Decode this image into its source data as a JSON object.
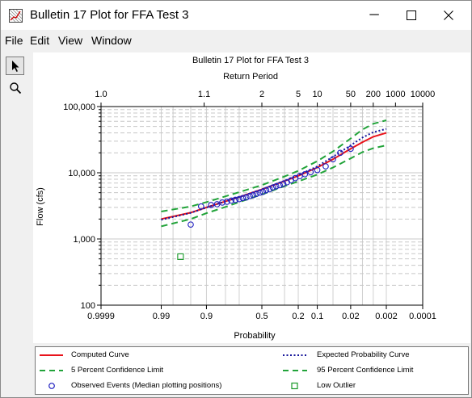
{
  "window": {
    "title": "Bulletin 17 Plot for FFA Test 3",
    "minimize_glyph": "─",
    "maximize_glyph": "☐",
    "close_glyph": "✕"
  },
  "menu": {
    "items": [
      "File",
      "Edit",
      "View",
      "Window"
    ]
  },
  "toolbar": {
    "tools": [
      "pointer-tool",
      "zoom-tool"
    ]
  },
  "chart_data": {
    "type": "line",
    "title": "Bulletin 17 Plot for FFA Test 3",
    "top_axis_label": "Return Period",
    "xlabel": "Probability",
    "ylabel": "Flow (cfs)",
    "y_scale": "log",
    "ylim": [
      100,
      100000
    ],
    "x_scale": "probability",
    "xlim": [
      0.9999,
      0.0001
    ],
    "x_ticks": [
      0.9999,
      0.99,
      0.9,
      0.5,
      0.2,
      0.1,
      0.02,
      0.002,
      0.0001
    ],
    "x_tick_labels": [
      "0.9999",
      "0.99",
      "0.9",
      "0.5",
      "0.2",
      "0.1",
      "0.02",
      "0.002",
      "0.0001"
    ],
    "top_ticks": [
      1.0,
      1.1,
      2,
      5,
      10,
      50,
      200,
      1000,
      10000
    ],
    "top_tick_labels": [
      "1.0",
      "1.1",
      "2",
      "5",
      "10",
      "50",
      "200",
      "1000",
      "10000"
    ],
    "y_ticks": [
      100,
      1000,
      10000,
      100000
    ],
    "y_tick_labels": [
      "100",
      "1,000",
      "10,000",
      "100,000"
    ],
    "grid": true,
    "legend_placement": "bottom",
    "series": [
      {
        "name": "Computed Curve",
        "color": "#e8131b",
        "style": "solid",
        "points": [
          [
            0.99,
            2000
          ],
          [
            0.95,
            2500
          ],
          [
            0.9,
            3000
          ],
          [
            0.8,
            3700
          ],
          [
            0.7,
            4300
          ],
          [
            0.5,
            5600
          ],
          [
            0.3,
            7500
          ],
          [
            0.2,
            9000
          ],
          [
            0.1,
            12000
          ],
          [
            0.05,
            16000
          ],
          [
            0.02,
            23000
          ],
          [
            0.01,
            29000
          ],
          [
            0.005,
            35000
          ],
          [
            0.002,
            40000
          ]
        ]
      },
      {
        "name": "Expected Probability Curve",
        "color": "#15159a",
        "style": "dotted",
        "points": [
          [
            0.99,
            1950
          ],
          [
            0.95,
            2480
          ],
          [
            0.9,
            2980
          ],
          [
            0.8,
            3700
          ],
          [
            0.7,
            4300
          ],
          [
            0.5,
            5600
          ],
          [
            0.3,
            7600
          ],
          [
            0.2,
            9200
          ],
          [
            0.1,
            12500
          ],
          [
            0.05,
            17500
          ],
          [
            0.02,
            26000
          ],
          [
            0.01,
            34000
          ],
          [
            0.005,
            41000
          ],
          [
            0.002,
            46000
          ]
        ]
      },
      {
        "name": "5 Percent Confidence Limit",
        "color": "#22a33a",
        "style": "dashed",
        "points": [
          [
            0.99,
            2600
          ],
          [
            0.95,
            3100
          ],
          [
            0.9,
            3600
          ],
          [
            0.8,
            4400
          ],
          [
            0.7,
            5100
          ],
          [
            0.5,
            6500
          ],
          [
            0.3,
            8800
          ],
          [
            0.2,
            10700
          ],
          [
            0.1,
            15000
          ],
          [
            0.05,
            21000
          ],
          [
            0.02,
            33000
          ],
          [
            0.01,
            45000
          ],
          [
            0.005,
            55000
          ],
          [
            0.002,
            62000
          ]
        ]
      },
      {
        "name": "95 Percent Confidence Limit",
        "color": "#22a33a",
        "style": "dashed",
        "points": [
          [
            0.99,
            1550
          ],
          [
            0.95,
            2000
          ],
          [
            0.9,
            2450
          ],
          [
            0.8,
            3050
          ],
          [
            0.7,
            3600
          ],
          [
            0.5,
            4700
          ],
          [
            0.3,
            6300
          ],
          [
            0.2,
            7400
          ],
          [
            0.1,
            9400
          ],
          [
            0.05,
            12000
          ],
          [
            0.02,
            16500
          ],
          [
            0.01,
            20500
          ],
          [
            0.005,
            23500
          ],
          [
            0.002,
            26000
          ]
        ]
      }
    ],
    "observed_events": {
      "name": "Observed Events (Median plotting positions)",
      "color": "#2020c0",
      "points": [
        [
          0.95,
          1650
        ],
        [
          0.92,
          3100
        ],
        [
          0.88,
          3250
        ],
        [
          0.85,
          3350
        ],
        [
          0.82,
          3550
        ],
        [
          0.79,
          3650
        ],
        [
          0.76,
          3800
        ],
        [
          0.73,
          3900
        ],
        [
          0.7,
          4000
        ],
        [
          0.67,
          4150
        ],
        [
          0.64,
          4250
        ],
        [
          0.61,
          4450
        ],
        [
          0.58,
          4600
        ],
        [
          0.55,
          4800
        ],
        [
          0.52,
          5000
        ],
        [
          0.49,
          5150
        ],
        [
          0.46,
          5450
        ],
        [
          0.43,
          5650
        ],
        [
          0.4,
          6000
        ],
        [
          0.37,
          6250
        ],
        [
          0.34,
          6500
        ],
        [
          0.31,
          6800
        ],
        [
          0.28,
          7200
        ],
        [
          0.25,
          7700
        ],
        [
          0.22,
          8300
        ],
        [
          0.19,
          8900
        ],
        [
          0.16,
          9500
        ],
        [
          0.13,
          10200
        ],
        [
          0.1,
          11000
        ],
        [
          0.07,
          12500
        ],
        [
          0.05,
          16000
        ],
        [
          0.035,
          20000
        ],
        [
          0.02,
          23000
        ]
      ]
    },
    "low_outlier": {
      "name": "Low Outlier",
      "color": "#1a9a2a",
      "points": [
        [
          0.97,
          540
        ]
      ]
    }
  }
}
